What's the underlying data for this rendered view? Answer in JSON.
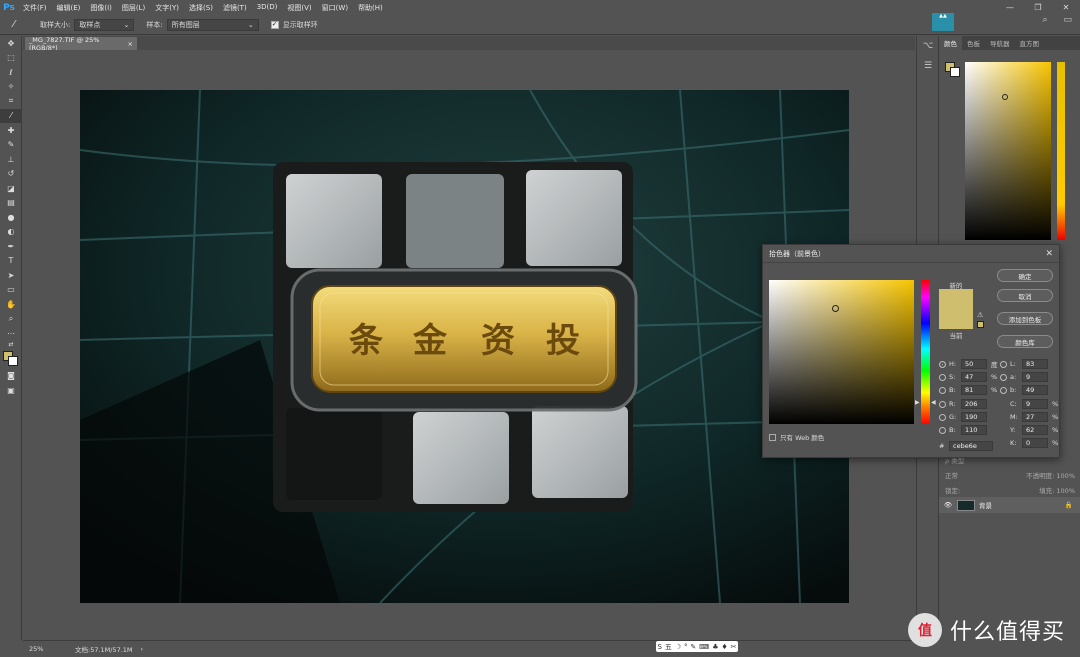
{
  "app": {
    "logo": "Ps"
  },
  "menu": [
    "文件(F)",
    "编辑(E)",
    "图像(I)",
    "图层(L)",
    "文字(Y)",
    "选择(S)",
    "滤镜(T)",
    "3D(D)",
    "视图(V)",
    "窗口(W)",
    "帮助(H)"
  ],
  "window_controls": {
    "minimize": "—",
    "restore": "❐",
    "close": "✕"
  },
  "options": {
    "sample_size_label": "取样大小:",
    "sample_size_value": "取样点",
    "sample_label": "样本:",
    "sample_value": "所有图层",
    "show_ring_label": "显示取样环",
    "show_ring_checked": true
  },
  "document": {
    "tab_title": "_MG_7827.TIF @ 25%(RGB/8*)",
    "tab_close": "×"
  },
  "status": {
    "zoom": "25%",
    "doc_size": "文档:57.1M/57.1M",
    "arrow": "›"
  },
  "ime": [
    "S",
    "五",
    "☽",
    "°",
    "✎",
    "⌨",
    "♣",
    "♦",
    "✂"
  ],
  "photo": {
    "bar_text": [
      "投",
      "资",
      "金",
      "条"
    ]
  },
  "right_panel": {
    "tabs": [
      "颜色",
      "色板",
      "导航器",
      "直方图"
    ],
    "layers_kind": "ρ 类型",
    "layers_mode": "正常",
    "layers_opacity": "不透明度: 100%",
    "layers_lock": "锁定:",
    "layers_fill": "填充: 100%",
    "layer_name": "背景"
  },
  "logo": {
    "mark": "值",
    "text": "什么值得买"
  },
  "picker": {
    "title": "拾色器（前景色）",
    "close": "✕",
    "new_label": "新的",
    "current_label": "当前",
    "buttons": {
      "ok": "确定",
      "cancel": "取消",
      "add_swatch": "添加到色板",
      "libraries": "颜色库"
    },
    "hsb": [
      {
        "label": "H:",
        "value": "50",
        "unit": "度",
        "selected": true
      },
      {
        "label": "S:",
        "value": "47",
        "unit": "%",
        "selected": false
      },
      {
        "label": "B:",
        "value": "81",
        "unit": "%",
        "selected": false
      }
    ],
    "rgb": [
      {
        "label": "R:",
        "value": "206"
      },
      {
        "label": "G:",
        "value": "190"
      },
      {
        "label": "B:",
        "value": "110"
      }
    ],
    "lab": [
      {
        "label": "L:",
        "value": "83"
      },
      {
        "label": "a:",
        "value": "9"
      },
      {
        "label": "b:",
        "value": "49"
      }
    ],
    "cmyk": [
      {
        "label": "C:",
        "value": "9",
        "unit": "%"
      },
      {
        "label": "M:",
        "value": "27",
        "unit": "%"
      },
      {
        "label": "Y:",
        "value": "62",
        "unit": "%"
      },
      {
        "label": "K:",
        "value": "0",
        "unit": "%"
      }
    ],
    "hex_label": "#",
    "hex": "cebe6e",
    "web_only_label": "只有 Web 颜色",
    "web_only_checked": false
  },
  "colors": {
    "foreground": "#cebe6e",
    "accent": "#31a8ff",
    "hue_pure": "#f7c400"
  }
}
